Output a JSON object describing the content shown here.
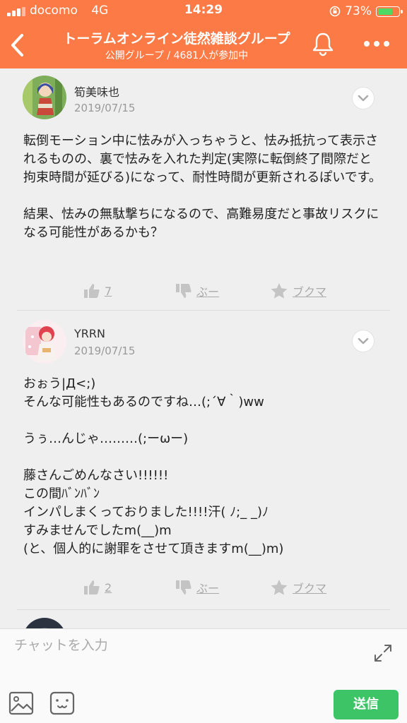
{
  "status_bar": {
    "carrier": "docomo",
    "network": "4G",
    "time": "14:29",
    "battery": "73%",
    "battery_level": 0.73
  },
  "header": {
    "title": "トーラムオンライン徒然雑談グループ",
    "subtitle": "公開グループ / 4681人が参加中"
  },
  "posts": [
    {
      "author": "筍美味也",
      "date": "2019/07/15",
      "body": "転倒モーション中に怯みが入っちゃうと、怯み抵抗って表示されるものの、裏で怯みを入れた判定(実際に転倒終了間際だと拘束時間が延びる)になって、耐性時間が更新されるぽいです。\n\n結果、怯みの無駄撃ちになるので、高難易度だと事故リスクになる可能性があるかも？",
      "likes": "7",
      "dislike_label": "ぶー",
      "bookmark_label": "ブクマ"
    },
    {
      "author": "YRRN",
      "date": "2019/07/15",
      "body": "おぉう|Д<;)\nそんな可能性もあるのですね…(;´∀｀)ww\n\nうぅ…んじゃ………(;ーωー)\n\n藤さんごめんなさい!!!!!!\nこの間ﾊﾞﾝﾊﾞﾝ\nインパしまくっておりました!!!!汗( ﾉ;_ _)ﾉ\nすみませんでしたm(__)m\n(と、個人的に謝罪をさせて頂きますm(__)m)",
      "likes": "2",
      "dislike_label": "ぶー",
      "bookmark_label": "ブクマ"
    }
  ],
  "composer": {
    "placeholder": "チャットを入力",
    "send_label": "送信"
  },
  "colors": {
    "header": "#fc7a45",
    "send": "#3dc466",
    "background": "#efeff0"
  }
}
